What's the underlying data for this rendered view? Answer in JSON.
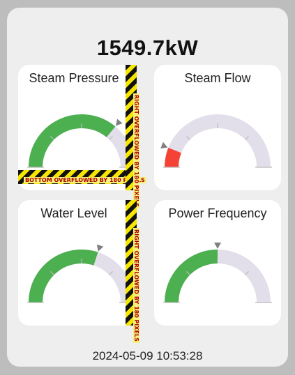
{
  "power": {
    "value": "1549.7kW"
  },
  "gauges": [
    {
      "label": "Steam Pressure",
      "value": 0.72,
      "color": "#4caf50"
    },
    {
      "label": "Steam Flow",
      "value": 0.12,
      "color": "#f44336"
    },
    {
      "label": "Water Level",
      "value": 0.6,
      "color": "#4caf50"
    },
    {
      "label": "Power Frequency",
      "value": 0.5,
      "color": "#4caf50"
    }
  ],
  "colors": {
    "track": "#e3dfea",
    "tick": "#bbbbbb",
    "pointer": "#808080"
  },
  "overflow": {
    "bottom_text": "BOTTOM OVERFLOWED BY 180 PIXELS",
    "right_text_top": "RIGHT OVERFLOWED BY 180 PIXELS",
    "right_text_bottom": "RIGHT OVERFLOWED BY 180 PIXELS"
  },
  "timestamp": "2024-05-09 10:53:28"
}
